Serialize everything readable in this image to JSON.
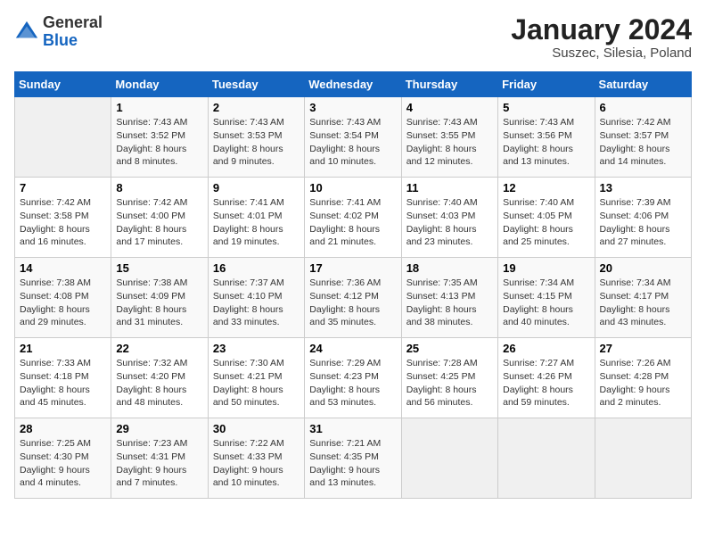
{
  "header": {
    "logo_general": "General",
    "logo_blue": "Blue",
    "month_year": "January 2024",
    "location": "Suszec, Silesia, Poland"
  },
  "days_of_week": [
    "Sunday",
    "Monday",
    "Tuesday",
    "Wednesday",
    "Thursday",
    "Friday",
    "Saturday"
  ],
  "weeks": [
    [
      {
        "day": "",
        "info": ""
      },
      {
        "day": "1",
        "info": "Sunrise: 7:43 AM\nSunset: 3:52 PM\nDaylight: 8 hours\nand 8 minutes."
      },
      {
        "day": "2",
        "info": "Sunrise: 7:43 AM\nSunset: 3:53 PM\nDaylight: 8 hours\nand 9 minutes."
      },
      {
        "day": "3",
        "info": "Sunrise: 7:43 AM\nSunset: 3:54 PM\nDaylight: 8 hours\nand 10 minutes."
      },
      {
        "day": "4",
        "info": "Sunrise: 7:43 AM\nSunset: 3:55 PM\nDaylight: 8 hours\nand 12 minutes."
      },
      {
        "day": "5",
        "info": "Sunrise: 7:43 AM\nSunset: 3:56 PM\nDaylight: 8 hours\nand 13 minutes."
      },
      {
        "day": "6",
        "info": "Sunrise: 7:42 AM\nSunset: 3:57 PM\nDaylight: 8 hours\nand 14 minutes."
      }
    ],
    [
      {
        "day": "7",
        "info": "Sunrise: 7:42 AM\nSunset: 3:58 PM\nDaylight: 8 hours\nand 16 minutes."
      },
      {
        "day": "8",
        "info": "Sunrise: 7:42 AM\nSunset: 4:00 PM\nDaylight: 8 hours\nand 17 minutes."
      },
      {
        "day": "9",
        "info": "Sunrise: 7:41 AM\nSunset: 4:01 PM\nDaylight: 8 hours\nand 19 minutes."
      },
      {
        "day": "10",
        "info": "Sunrise: 7:41 AM\nSunset: 4:02 PM\nDaylight: 8 hours\nand 21 minutes."
      },
      {
        "day": "11",
        "info": "Sunrise: 7:40 AM\nSunset: 4:03 PM\nDaylight: 8 hours\nand 23 minutes."
      },
      {
        "day": "12",
        "info": "Sunrise: 7:40 AM\nSunset: 4:05 PM\nDaylight: 8 hours\nand 25 minutes."
      },
      {
        "day": "13",
        "info": "Sunrise: 7:39 AM\nSunset: 4:06 PM\nDaylight: 8 hours\nand 27 minutes."
      }
    ],
    [
      {
        "day": "14",
        "info": "Sunrise: 7:38 AM\nSunset: 4:08 PM\nDaylight: 8 hours\nand 29 minutes."
      },
      {
        "day": "15",
        "info": "Sunrise: 7:38 AM\nSunset: 4:09 PM\nDaylight: 8 hours\nand 31 minutes."
      },
      {
        "day": "16",
        "info": "Sunrise: 7:37 AM\nSunset: 4:10 PM\nDaylight: 8 hours\nand 33 minutes."
      },
      {
        "day": "17",
        "info": "Sunrise: 7:36 AM\nSunset: 4:12 PM\nDaylight: 8 hours\nand 35 minutes."
      },
      {
        "day": "18",
        "info": "Sunrise: 7:35 AM\nSunset: 4:13 PM\nDaylight: 8 hours\nand 38 minutes."
      },
      {
        "day": "19",
        "info": "Sunrise: 7:34 AM\nSunset: 4:15 PM\nDaylight: 8 hours\nand 40 minutes."
      },
      {
        "day": "20",
        "info": "Sunrise: 7:34 AM\nSunset: 4:17 PM\nDaylight: 8 hours\nand 43 minutes."
      }
    ],
    [
      {
        "day": "21",
        "info": "Sunrise: 7:33 AM\nSunset: 4:18 PM\nDaylight: 8 hours\nand 45 minutes."
      },
      {
        "day": "22",
        "info": "Sunrise: 7:32 AM\nSunset: 4:20 PM\nDaylight: 8 hours\nand 48 minutes."
      },
      {
        "day": "23",
        "info": "Sunrise: 7:30 AM\nSunset: 4:21 PM\nDaylight: 8 hours\nand 50 minutes."
      },
      {
        "day": "24",
        "info": "Sunrise: 7:29 AM\nSunset: 4:23 PM\nDaylight: 8 hours\nand 53 minutes."
      },
      {
        "day": "25",
        "info": "Sunrise: 7:28 AM\nSunset: 4:25 PM\nDaylight: 8 hours\nand 56 minutes."
      },
      {
        "day": "26",
        "info": "Sunrise: 7:27 AM\nSunset: 4:26 PM\nDaylight: 8 hours\nand 59 minutes."
      },
      {
        "day": "27",
        "info": "Sunrise: 7:26 AM\nSunset: 4:28 PM\nDaylight: 9 hours\nand 2 minutes."
      }
    ],
    [
      {
        "day": "28",
        "info": "Sunrise: 7:25 AM\nSunset: 4:30 PM\nDaylight: 9 hours\nand 4 minutes."
      },
      {
        "day": "29",
        "info": "Sunrise: 7:23 AM\nSunset: 4:31 PM\nDaylight: 9 hours\nand 7 minutes."
      },
      {
        "day": "30",
        "info": "Sunrise: 7:22 AM\nSunset: 4:33 PM\nDaylight: 9 hours\nand 10 minutes."
      },
      {
        "day": "31",
        "info": "Sunrise: 7:21 AM\nSunset: 4:35 PM\nDaylight: 9 hours\nand 13 minutes."
      },
      {
        "day": "",
        "info": ""
      },
      {
        "day": "",
        "info": ""
      },
      {
        "day": "",
        "info": ""
      }
    ]
  ]
}
